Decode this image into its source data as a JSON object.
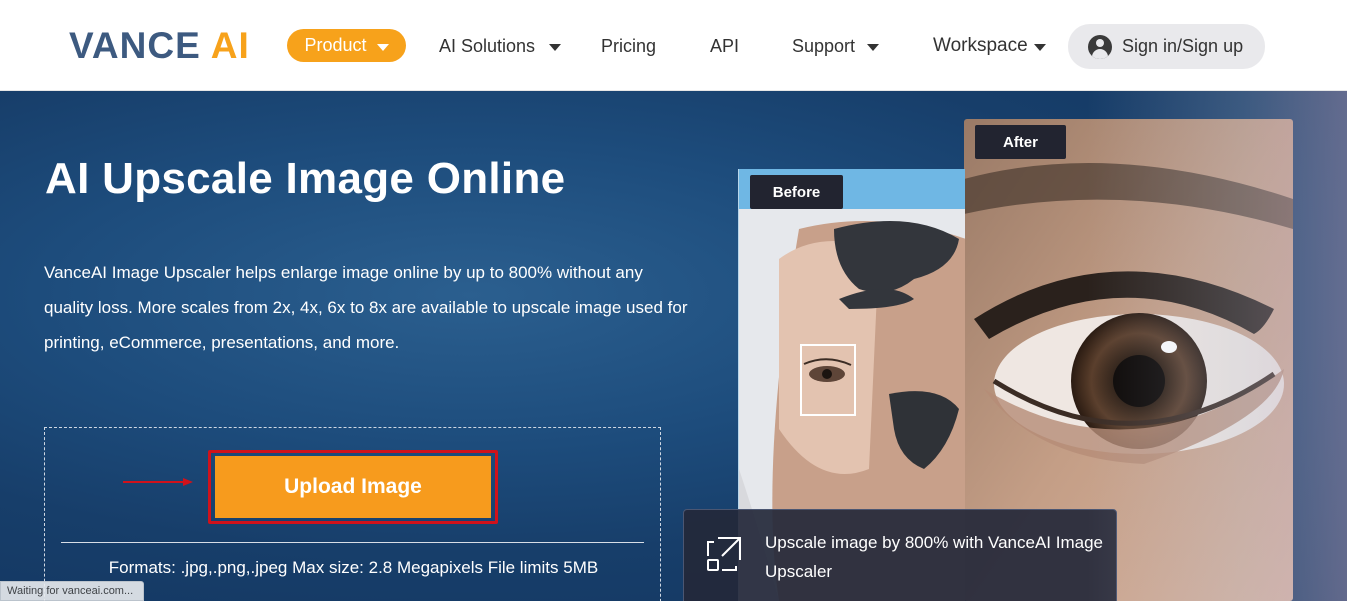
{
  "nav": {
    "logo_left": "VANCE",
    "logo_right": "AI",
    "product": "Product",
    "ai_solutions": "AI Solutions",
    "pricing": "Pricing",
    "api": "API",
    "support": "Support",
    "workspace": "Workspace",
    "signin": "Sign in/Sign up"
  },
  "hero": {
    "title": "AI Upscale Image Online",
    "description": "VanceAI Image Upscaler helps enlarge image online by up to 800% without any quality loss. More scales from 2x, 4x, 6x to 8x are available to upscale image used for printing, eCommerce, presentations, and more.",
    "upload_button": "Upload Image",
    "formats": "Formats: .jpg,.png,.jpeg Max size: 2.8 Megapixels File limits 5MB"
  },
  "compare": {
    "before_label": "Before",
    "after_label": "After",
    "caption": "Upscale image by 800% with VanceAI Image Upscaler"
  },
  "status_bar": "Waiting for vanceai.com...",
  "colors": {
    "brand_orange": "#f7a21b",
    "brand_blue": "#3d5a80",
    "highlight_red": "#d0121b",
    "hero_blue": "#1d4c7c"
  },
  "icons": [
    "caret-down-icon",
    "user-avatar-icon",
    "arrow-right-icon",
    "expand-icon"
  ]
}
